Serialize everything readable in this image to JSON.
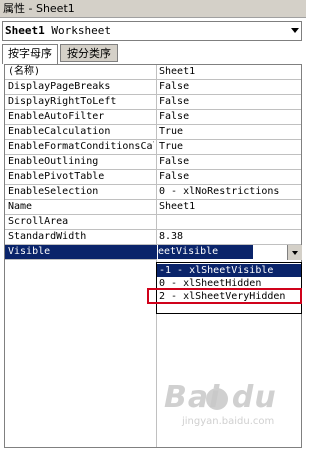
{
  "window": {
    "title": "属性 - Sheet1"
  },
  "object_selector": {
    "name": "Sheet1",
    "type": "Worksheet"
  },
  "tabs": [
    {
      "label": "按字母序",
      "active": true
    },
    {
      "label": "按分类序",
      "active": false
    }
  ],
  "properties": [
    {
      "name": "(名称)",
      "value": "Sheet1"
    },
    {
      "name": "DisplayPageBreaks",
      "value": "False"
    },
    {
      "name": "DisplayRightToLeft",
      "value": "False"
    },
    {
      "name": "EnableAutoFilter",
      "value": "False"
    },
    {
      "name": "EnableCalculation",
      "value": "True"
    },
    {
      "name": "EnableFormatConditionsCal",
      "value": "True"
    },
    {
      "name": "EnableOutlining",
      "value": "False"
    },
    {
      "name": "EnablePivotTable",
      "value": "False"
    },
    {
      "name": "EnableSelection",
      "value": "0 - xlNoRestrictions"
    },
    {
      "name": "Name",
      "value": "Sheet1"
    },
    {
      "name": "ScrollArea",
      "value": ""
    },
    {
      "name": "StandardWidth",
      "value": "8.38"
    },
    {
      "name": "Visible",
      "value": "eetVisible",
      "selected": true
    }
  ],
  "dropdown": {
    "options": [
      {
        "label": "-1 - xlSheetVisible",
        "highlighted": true
      },
      {
        "label": "0 - xlSheetHidden",
        "highlighted": false
      },
      {
        "label": "2 - xlSheetVeryHidden",
        "highlighted": false,
        "annotated": true
      }
    ]
  },
  "annotation": {
    "color": "#d0021b"
  },
  "watermark": {
    "logo": "Bai du",
    "subtext": "jingyan.baidu.com"
  },
  "colors": {
    "selection": "#0a246a",
    "chrome": "#d4d0c8",
    "annotation_red": "#d0021b"
  }
}
